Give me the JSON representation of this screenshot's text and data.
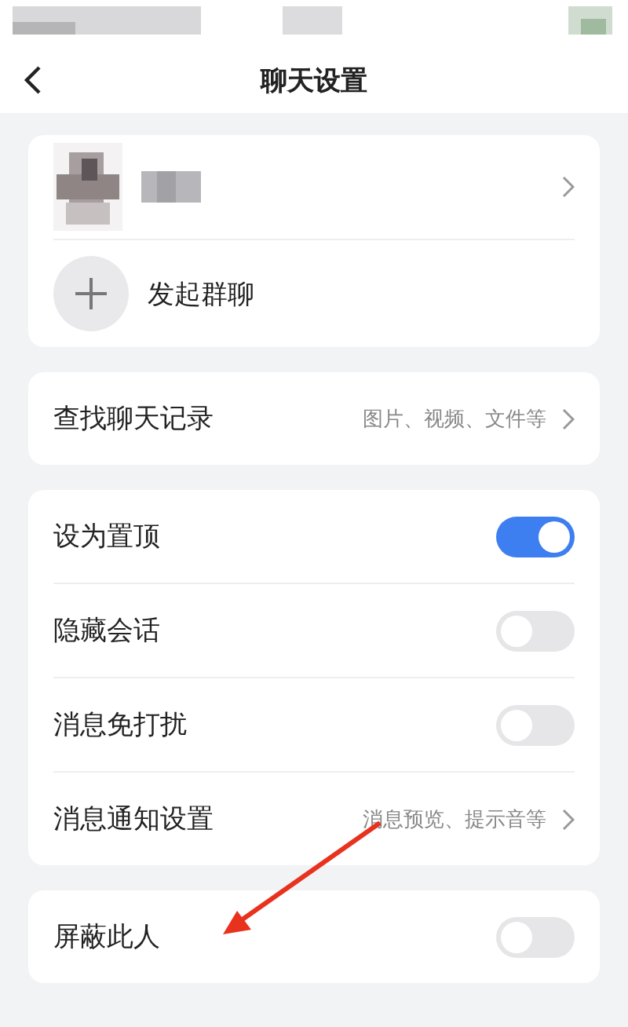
{
  "header": {
    "title": "聊天设置"
  },
  "contact_card": {
    "action": {
      "label": "发起群聊"
    }
  },
  "search_row": {
    "label": "查找聊天记录",
    "detail": "图片、视频、文件等"
  },
  "settings": [
    {
      "kind": "toggle",
      "label": "设为置顶",
      "on": true
    },
    {
      "kind": "toggle",
      "label": "隐藏会话",
      "on": false
    },
    {
      "kind": "toggle",
      "label": "消息免打扰",
      "on": false
    },
    {
      "kind": "link",
      "label": "消息通知设置",
      "detail": "消息预览、提示音等"
    }
  ],
  "privacy": [
    {
      "kind": "toggle",
      "label": "屏蔽此人",
      "on": false
    }
  ]
}
